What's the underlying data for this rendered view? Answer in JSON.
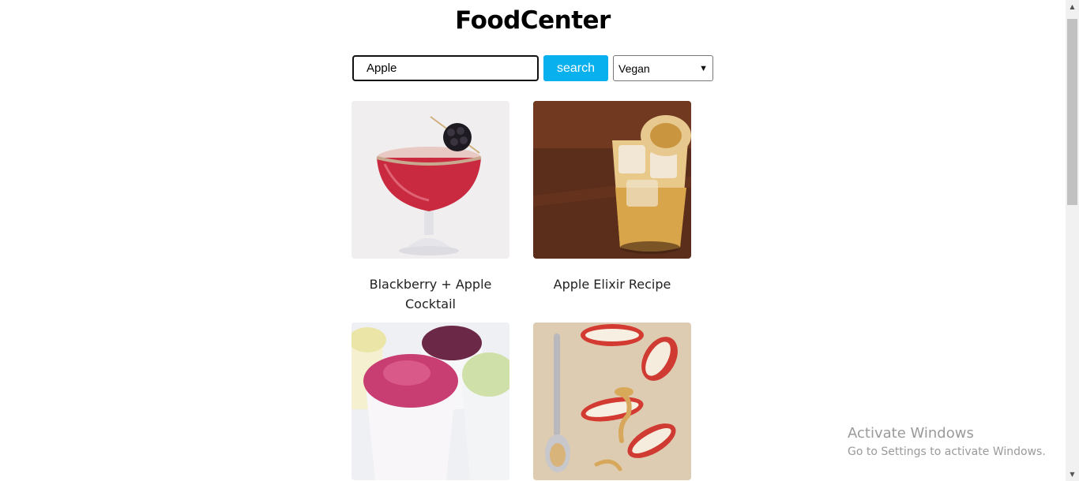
{
  "app": {
    "title": "FoodCenter"
  },
  "search": {
    "value": "Apple",
    "button_label": "search",
    "diet_selected": "Vegan"
  },
  "recipes": [
    {
      "name": "Blackberry + Apple Cocktail"
    },
    {
      "name": "Apple Elixir Recipe"
    },
    {
      "name": ""
    },
    {
      "name": ""
    }
  ],
  "watermark": {
    "line1": "Activate Windows",
    "line2": "Go to Settings to activate Windows."
  }
}
